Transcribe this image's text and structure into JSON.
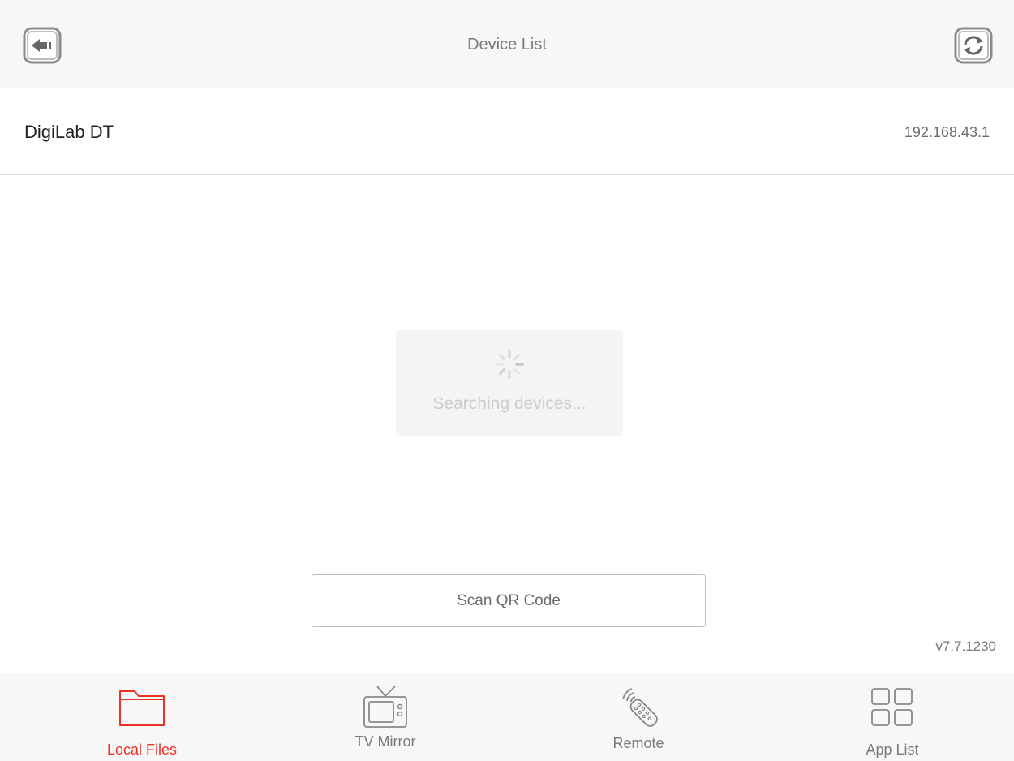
{
  "header": {
    "title": "Device List",
    "back_icon": "back-arrow-icon",
    "refresh_icon": "refresh-icon"
  },
  "devices": [
    {
      "name": "DigiLab DT",
      "ip": "192.168.43.1"
    }
  ],
  "loading": {
    "text": "Searching devices...",
    "icon": "spinner-icon"
  },
  "scan_button": {
    "label": "Scan QR Code"
  },
  "version": "v7.7.1230",
  "tabs": [
    {
      "label": "Local Files",
      "icon": "folder-icon",
      "active": true
    },
    {
      "label": "TV Mirror",
      "icon": "tv-icon",
      "active": false
    },
    {
      "label": "Remote",
      "icon": "remote-icon",
      "active": false
    },
    {
      "label": "App List",
      "icon": "grid-icon",
      "active": false
    }
  ],
  "colors": {
    "accent": "#e8322a",
    "header_bg": "#f7f7f7",
    "text_muted": "#7a7a7a"
  }
}
